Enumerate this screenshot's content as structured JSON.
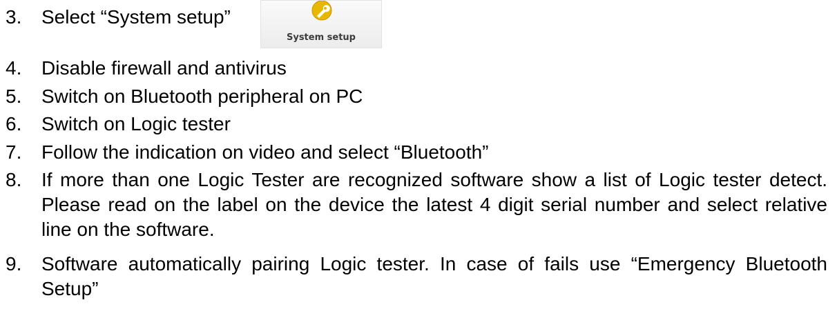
{
  "steps": [
    {
      "number": "3.",
      "text": "Select “System setup”"
    },
    {
      "number": "4.",
      "text": "Disable firewall and antivirus"
    },
    {
      "number": "5.",
      "text": "Switch on Bluetooth peripheral on PC"
    },
    {
      "number": "6.",
      "text": "Switch on Logic tester"
    },
    {
      "number": "7.",
      "text": "Follow the indication on video and select “Bluetooth”"
    },
    {
      "number": "8.",
      "text": "If more than one Logic Tester are recognized software show a list of Logic tester detect. Please read on the label on the device the latest 4 digit serial number and select relative line on the software."
    },
    {
      "number": "9.",
      "text": "Software automatically pairing Logic tester. In case of fails use “Emergency Bluetooth Setup”"
    }
  ],
  "system_setup_button": {
    "label": "System setup",
    "icon": "wrench-icon",
    "icon_color": "#e8b800"
  }
}
